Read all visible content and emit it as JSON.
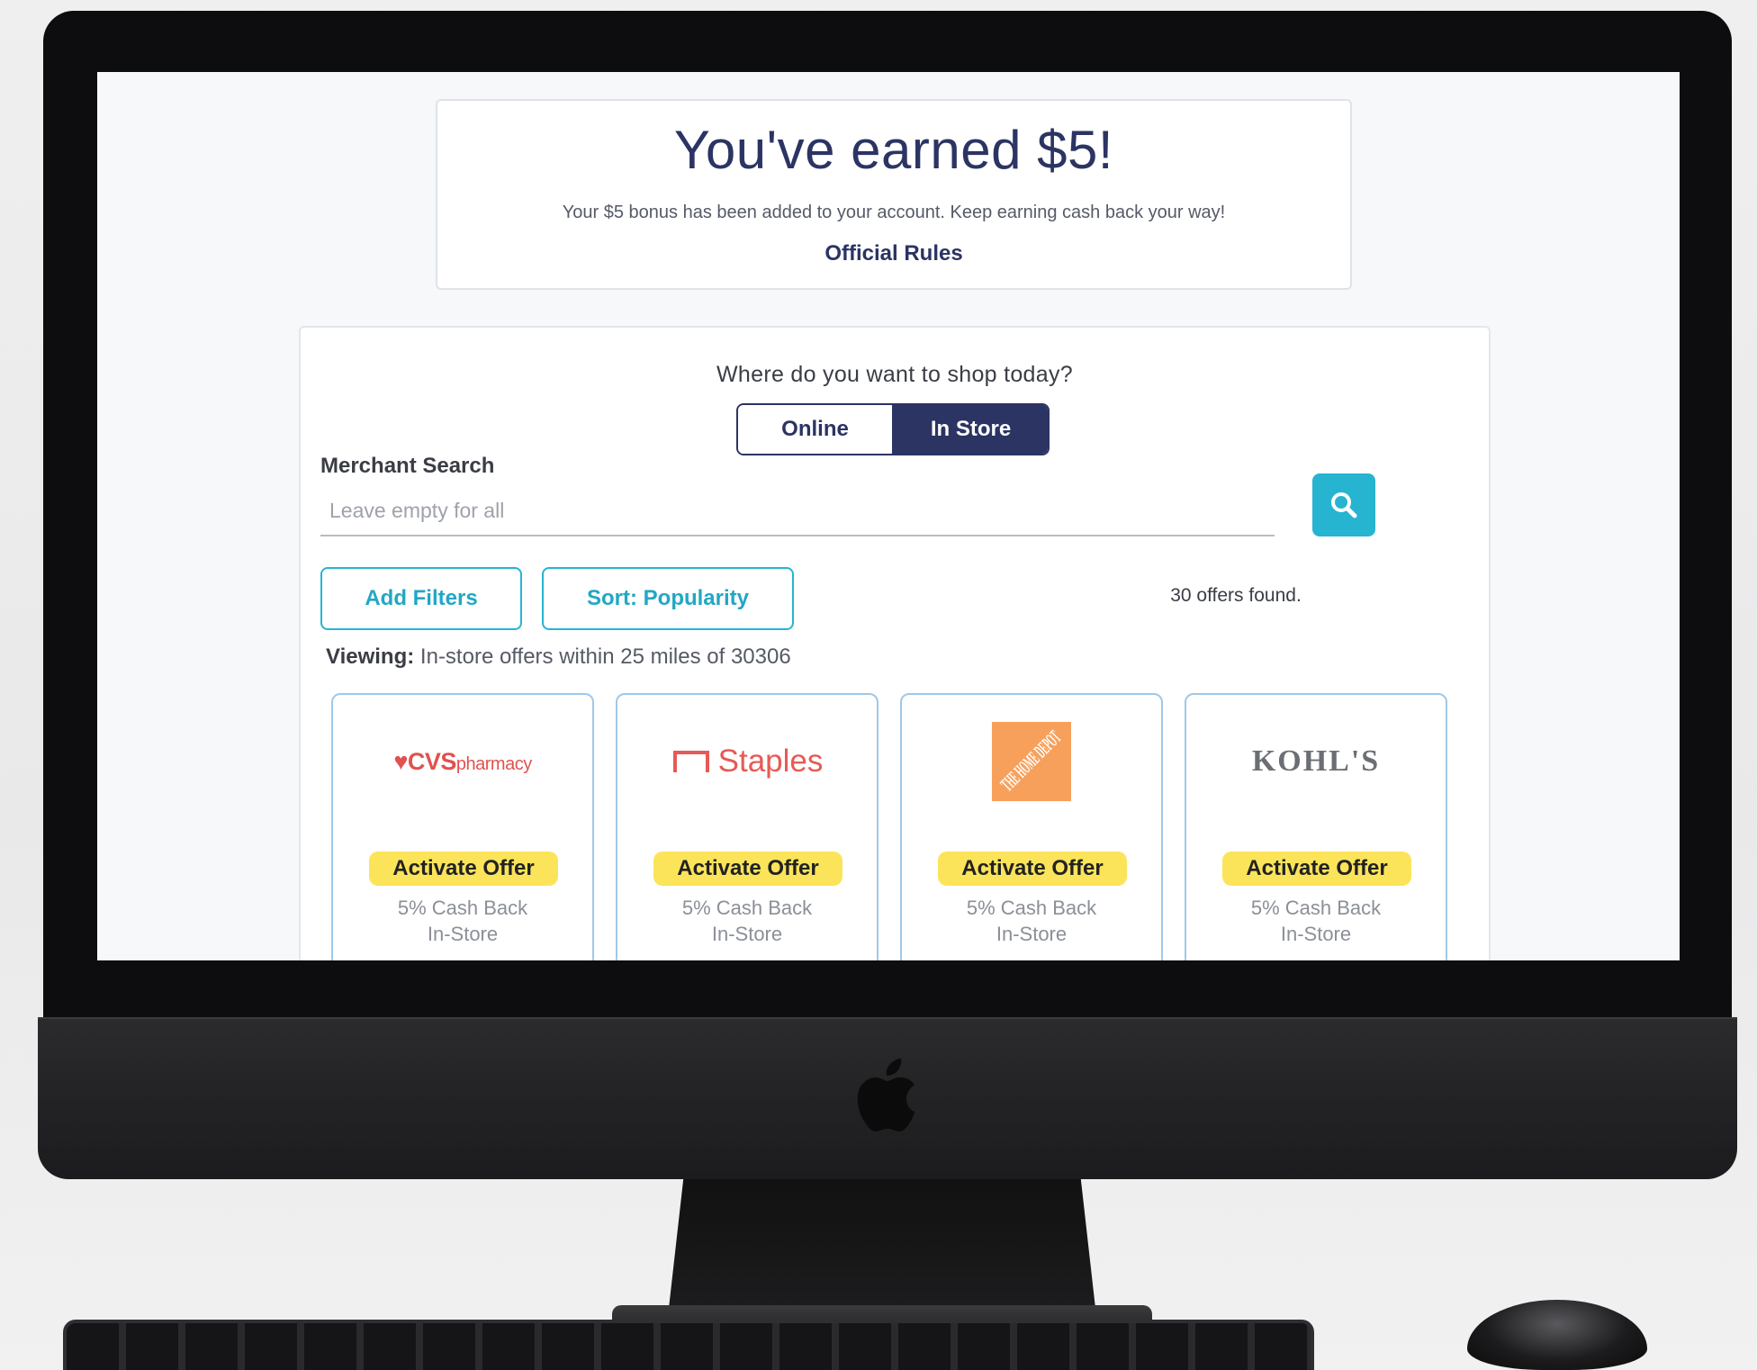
{
  "bonus": {
    "title": "You've earned $5!",
    "message": "Your $5 bonus has been added to your account. Keep earning cash back your way!",
    "rules_link": "Official Rules"
  },
  "shop": {
    "question": "Where do you want to shop today?",
    "toggle_online": "Online",
    "toggle_instore": "In Store",
    "selected": "In Store"
  },
  "search": {
    "label": "Merchant Search",
    "placeholder": "Leave empty for all",
    "value": ""
  },
  "filters": {
    "add_filters": "Add Filters",
    "sort": "Sort: Popularity",
    "offers_found": "30 offers found."
  },
  "viewing": {
    "label": "Viewing:",
    "text": "In-store offers within 25 miles of 30306"
  },
  "offers": [
    {
      "merchant": "CVS pharmacy",
      "logo_main": "CVS",
      "logo_sub": "pharmacy",
      "button": "Activate Offer",
      "cashback": "5% Cash Back",
      "location": "In-Store"
    },
    {
      "merchant": "Staples",
      "logo_main": "Staples",
      "button": "Activate Offer",
      "cashback": "5% Cash Back",
      "location": "In-Store"
    },
    {
      "merchant": "The Home Depot",
      "logo_main": "THE HOME DEPOT",
      "button": "Activate Offer",
      "cashback": "5% Cash Back",
      "location": "In-Store"
    },
    {
      "merchant": "Kohl's",
      "logo_main": "KOHL'S",
      "button": "Activate Offer",
      "cashback": "5% Cash Back",
      "location": "In-Store"
    }
  ],
  "colors": {
    "navy": "#2b3463",
    "teal": "#27b4d0",
    "yellow": "#fbe45a",
    "card_border": "#9fc8ea"
  },
  "icons": [
    "search-icon",
    "apple-logo-icon"
  ]
}
